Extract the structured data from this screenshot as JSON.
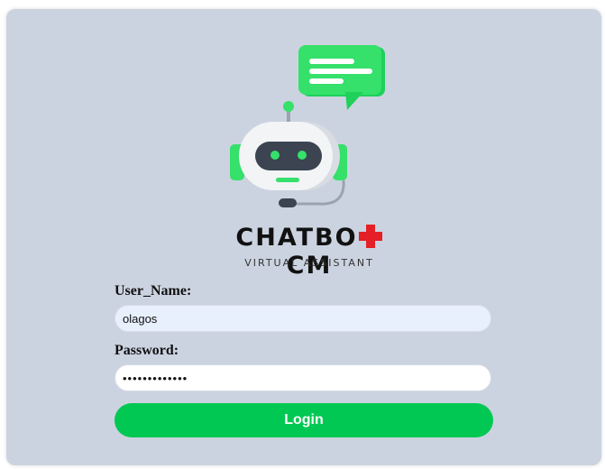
{
  "brand": {
    "name_left": "CHATBO",
    "name_right": "CM",
    "tagline": "VIRTUAL ASSISTANT",
    "logo_icon": "chatbot-robot-icon",
    "chat_bubble_icon": "chat-bubble-icon",
    "cross_icon": "red-cross-icon"
  },
  "form": {
    "username_label": "User_Name:",
    "username_value": "olagos",
    "password_label": "Password:",
    "password_value": "•••••••••••••",
    "login_label": "Login"
  },
  "colors": {
    "card_background": "#ccd3e0",
    "accent_green": "#00c853",
    "cross_red": "#e41f26",
    "username_field_bg": "#e8f0fe"
  }
}
